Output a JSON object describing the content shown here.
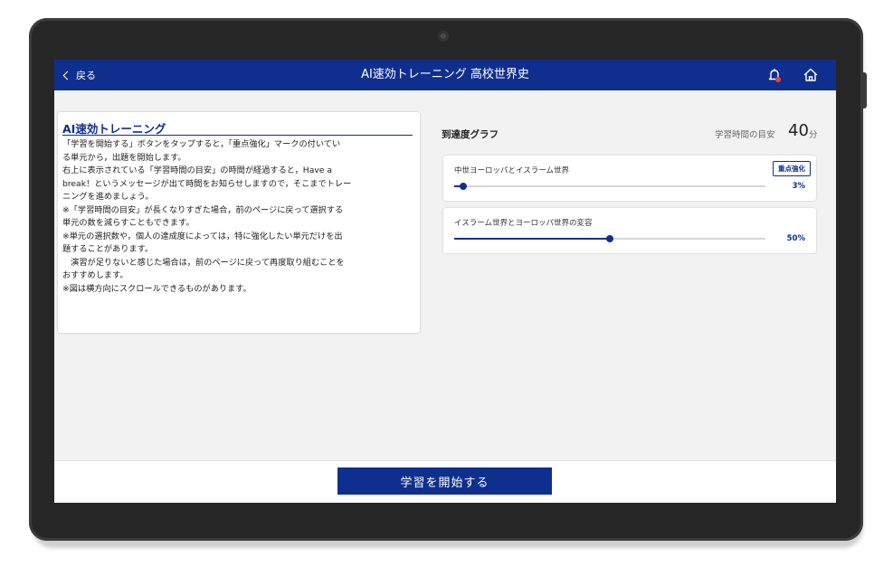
{
  "header": {
    "back_label": "戻る",
    "title": "AI速効トレーニング 高校世界史"
  },
  "info": {
    "title": "AI速効トレーニング",
    "lines": [
      "「学習を開始する」ボタンをタップすると，「重点強化」マークの付いてい",
      "る単元から，出題を開始します。",
      "右上に表示されている「学習時間の目安」の時間が経過すると，Have a",
      "break！というメッセージが出て時間をお知らせしますので，そこまでトレー",
      "ニングを進めましょう。",
      "※「学習時間の目安」が長くなりすぎた場合，前のページに戻って選択する",
      "単元の数を減らすこともできます。",
      "※単元の選択数や，個人の達成度によっては，特に強化したい単元だけを出",
      "題することがあります。",
      "　演習が足りないと感じた場合は，前のページに戻って再度取り組むことを",
      "おすすめします。",
      "※図は横方向にスクロールできるものがあります。"
    ]
  },
  "graph": {
    "title": "到達度グラフ",
    "goal_label": "学習時間の目安",
    "goal_value": "40",
    "goal_unit": "分",
    "units": [
      {
        "name": "中世ヨーロッパとイスラーム世界",
        "badge": "重点強化",
        "progress": 3,
        "percent_label": "3%"
      },
      {
        "name": "イスラーム世界とヨーロッパ世界の変容",
        "badge": "",
        "progress": 50,
        "percent_label": "50%"
      }
    ]
  },
  "footer": {
    "start_label": "学習を開始する"
  },
  "colors": {
    "primary": "#0f2f8f",
    "notification_dot": "#e8443a"
  },
  "icons": [
    "chevron-left-icon",
    "bell-icon",
    "home-icon"
  ]
}
